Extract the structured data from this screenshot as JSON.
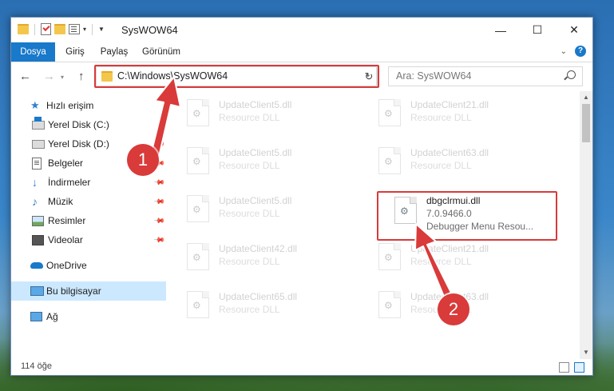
{
  "window": {
    "title": "SysWOW64"
  },
  "window_buttons": {
    "minimize": "—",
    "maximize": "☐",
    "close": "✕"
  },
  "ribbon": {
    "tabs": [
      "Dosya",
      "Giriş",
      "Paylaş",
      "Görünüm"
    ]
  },
  "address": {
    "path": "C:\\Windows\\SysWOW64",
    "search_placeholder": "Ara: SysWOW64"
  },
  "nav": {
    "items": [
      {
        "label": "Hızlı erişim",
        "icon": "star-icon",
        "pinned": false
      },
      {
        "label": "Yerel Disk (C:)",
        "icon": "disk-icon",
        "pinned": false
      },
      {
        "label": "Yerel Disk (D:)",
        "icon": "disk-icon",
        "pinned": true
      },
      {
        "label": "Belgeler",
        "icon": "document-icon",
        "pinned": true
      },
      {
        "label": "İndirmeler",
        "icon": "download-icon",
        "pinned": true
      },
      {
        "label": "Müzik",
        "icon": "music-icon",
        "pinned": true
      },
      {
        "label": "Resimler",
        "icon": "picture-icon",
        "pinned": true
      },
      {
        "label": "Videolar",
        "icon": "video-icon",
        "pinned": true
      },
      {
        "label": "OneDrive",
        "icon": "cloud-icon",
        "pinned": false
      },
      {
        "label": "Bu bilgisayar",
        "icon": "computer-icon",
        "pinned": false,
        "selected": true
      },
      {
        "label": "Ağ",
        "icon": "network-icon",
        "pinned": false
      }
    ]
  },
  "files": [
    {
      "name": "UpdateClient5.dll",
      "desc": "Resource DLL"
    },
    {
      "name": "UpdateClient21.dll",
      "desc": "Resource DLL"
    },
    {
      "name": "UpdateClient5.dll",
      "desc": "Resource DLL"
    },
    {
      "name": "UpdateClient63.dll",
      "desc": "Resource DLL"
    },
    {
      "name": "UpdateClient5.dll",
      "desc": "Resource DLL"
    },
    {
      "name": "dbgclrmui.dll",
      "version": "7.0.9466.0",
      "desc": "Debugger Menu Resou..."
    },
    {
      "name": "UpdateClient42.dll",
      "desc": "Resource DLL"
    },
    {
      "name": "UpdateClient21.dll",
      "desc": "Resource DLL"
    },
    {
      "name": "UpdateClient65.dll",
      "desc": "Resource DLL"
    },
    {
      "name": "UpdateClient63.dll",
      "desc": "Resource DLL"
    }
  ],
  "status": {
    "count": "114 öğe"
  },
  "annotations": {
    "step1": "1",
    "step2": "2",
    "color": "#d93a3a"
  }
}
